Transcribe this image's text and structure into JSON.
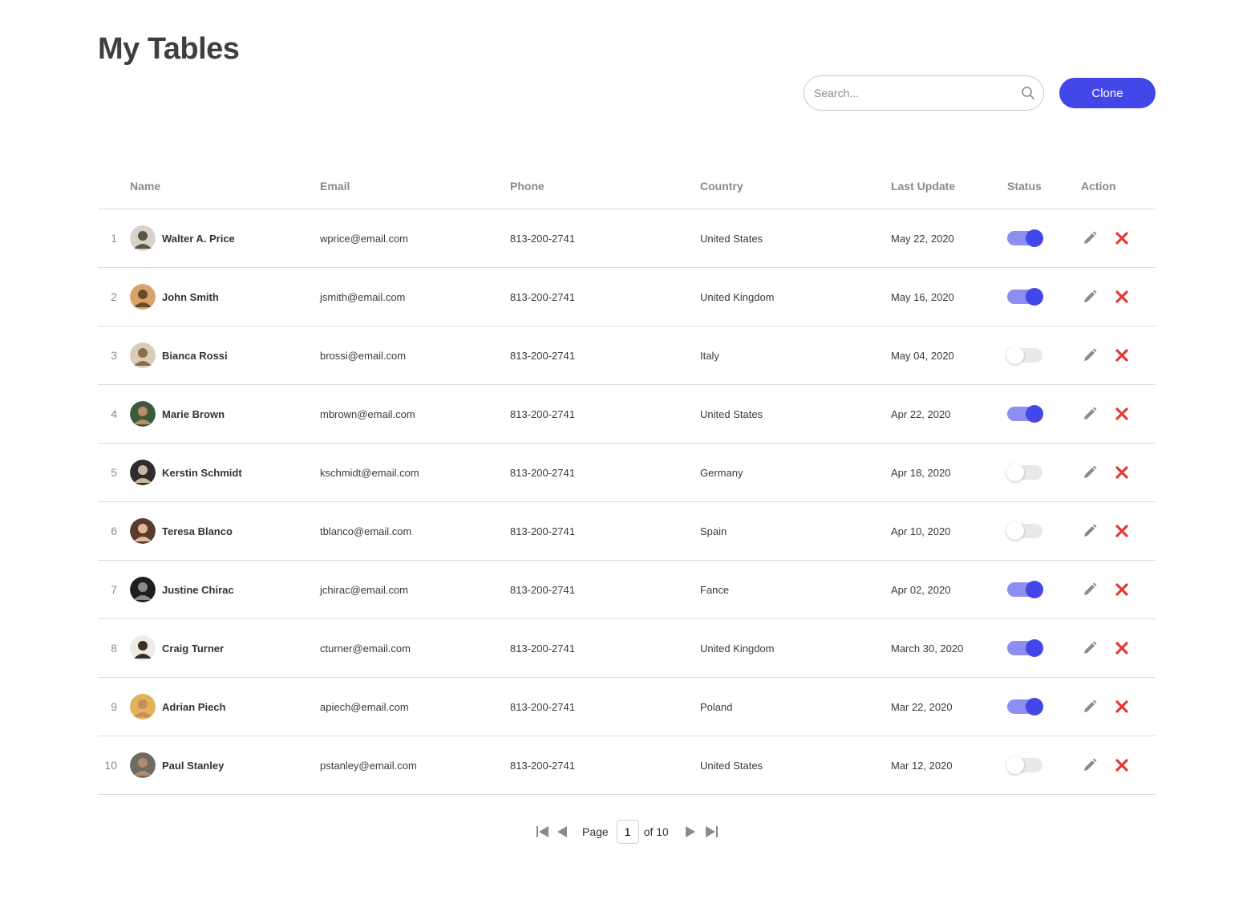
{
  "page": {
    "title": "My Tables"
  },
  "search": {
    "placeholder": "Search..."
  },
  "toolbar": {
    "clone_label": "Clone"
  },
  "table": {
    "columns": [
      "Name",
      "Email",
      "Phone",
      "Country",
      "Last Update",
      "Status",
      "Action"
    ],
    "rows": [
      {
        "num": "1",
        "name": "Walter A. Price",
        "email": "wprice@email.com",
        "phone": "813-200-2741",
        "country": "United States",
        "date": "May 22, 2020",
        "status": true
      },
      {
        "num": "2",
        "name": "John Smith",
        "email": "jsmith@email.com",
        "phone": "813-200-2741",
        "country": "United Kingdom",
        "date": "May 16, 2020",
        "status": true
      },
      {
        "num": "3",
        "name": "Bianca Rossi",
        "email": "brossi@email.com",
        "phone": "813-200-2741",
        "country": "Italy",
        "date": "May 04, 2020",
        "status": false
      },
      {
        "num": "4",
        "name": "Marie Brown",
        "email": "mbrown@email.com",
        "phone": "813-200-2741",
        "country": "United States",
        "date": "Apr 22, 2020",
        "status": true
      },
      {
        "num": "5",
        "name": "Kerstin Schmidt",
        "email": "kschmidt@email.com",
        "phone": "813-200-2741",
        "country": "Germany",
        "date": "Apr 18, 2020",
        "status": false
      },
      {
        "num": "6",
        "name": "Teresa Blanco",
        "email": "tblanco@email.com",
        "phone": "813-200-2741",
        "country": "Spain",
        "date": "Apr 10, 2020",
        "status": false
      },
      {
        "num": "7",
        "name": "Justine Chirac",
        "email": "jchirac@email.com",
        "phone": "813-200-2741",
        "country": "Fance",
        "date": "Apr 02, 2020",
        "status": true
      },
      {
        "num": "8",
        "name": "Craig Turner",
        "email": "cturner@email.com",
        "phone": "813-200-2741",
        "country": "United Kingdom",
        "date": "March 30, 2020",
        "status": true
      },
      {
        "num": "9",
        "name": "Adrian Piech",
        "email": "apiech@email.com",
        "phone": "813-200-2741",
        "country": "Poland",
        "date": "Mar 22, 2020",
        "status": true
      },
      {
        "num": "10",
        "name": "Paul Stanley",
        "email": "pstanley@email.com",
        "phone": "813-200-2741",
        "country": "United States",
        "date": "Mar 12, 2020",
        "status": false
      }
    ]
  },
  "pagination": {
    "page_label": "Page",
    "current": "1",
    "of_label": "of 10"
  },
  "icons": {
    "search": "search-icon",
    "edit": "pencil-icon",
    "delete": "close-icon",
    "first": "first-page-icon",
    "prev": "prev-page-icon",
    "next": "next-page-icon",
    "last": "last-page-icon"
  },
  "colors": {
    "accent": "#4347e8",
    "accent_light": "#8c8ef0",
    "delete": "#e53935",
    "edit": "#8a8a8a"
  }
}
